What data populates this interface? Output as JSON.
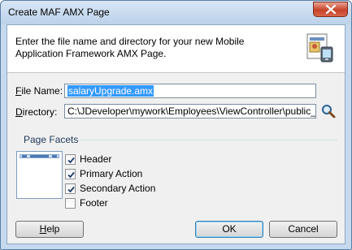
{
  "window": {
    "title": "Create MAF AMX Page",
    "close_icon": "close-icon"
  },
  "header": {
    "description": "Enter the file name and directory for your new Mobile Application Framework AMX Page.",
    "icon": "amx-page-icon"
  },
  "form": {
    "file_name_label_accel": "F",
    "file_name_label_rest": "ile Name:",
    "file_name_value": "salaryUpgrade.amx",
    "directory_label_accel": "D",
    "directory_label_rest": "irectory:",
    "directory_value": "C:\\JDeveloper\\mywork\\Employees\\ViewController\\public_html",
    "browse_icon": "search-icon"
  },
  "facets": {
    "title": "Page Facets",
    "items": [
      {
        "label": "Header",
        "checked": true
      },
      {
        "label": "Primary Action",
        "checked": true
      },
      {
        "label": "Secondary Action",
        "checked": true
      },
      {
        "label": "Footer",
        "checked": false
      }
    ]
  },
  "buttons": {
    "help_accel": "H",
    "help_rest": "elp",
    "ok": "OK",
    "cancel": "Cancel"
  },
  "colors": {
    "accent": "#3399ff",
    "group_title": "#1e395b",
    "close": "#c7432a"
  }
}
